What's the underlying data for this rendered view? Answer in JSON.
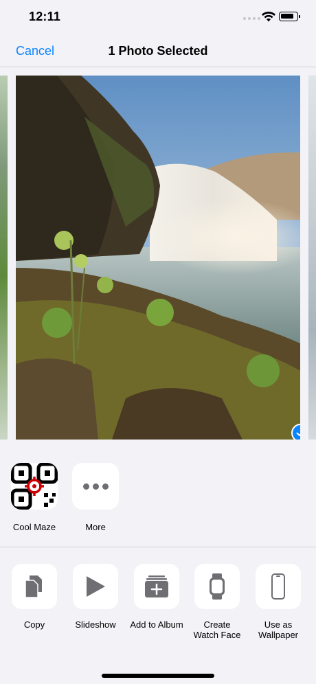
{
  "status_bar": {
    "time": "12:11"
  },
  "nav": {
    "cancel_label": "Cancel",
    "title": "1 Photo Selected"
  },
  "photo": {
    "selected": true,
    "check_icon": "checkmark-circle-icon"
  },
  "apps": [
    {
      "label": "Cool Maze",
      "icon": "qr-code-icon"
    },
    {
      "label": "More",
      "icon": "ellipsis-icon"
    }
  ],
  "actions": [
    {
      "label": "Copy",
      "icon": "copy-icon"
    },
    {
      "label": "Slideshow",
      "icon": "play-icon"
    },
    {
      "label": "Add to Album",
      "icon": "add-to-album-icon"
    },
    {
      "label": "Create Watch Face",
      "icon": "watch-icon"
    },
    {
      "label": "Use as Wallpaper",
      "icon": "phone-icon"
    }
  ],
  "colors": {
    "accent": "#0a84ff",
    "background": "#f2f2f7",
    "icon_gray": "#6e6e73"
  }
}
